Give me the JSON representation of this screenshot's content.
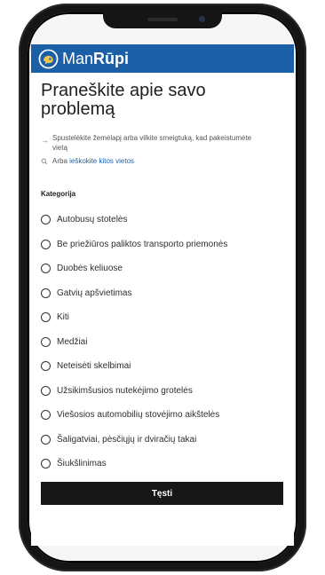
{
  "app": {
    "brand_part_1": "Man",
    "brand_part_2": "Rūpi",
    "icons": {
      "logo": "speech-bubble-logo",
      "search": "search-icon",
      "hint": "arrow-right-icon"
    },
    "colors": {
      "header": "#1b60a6",
      "link": "#1b63b0",
      "button": "#171717"
    }
  },
  "report": {
    "title": "Praneškite apie savo problemą",
    "map_hint": "Spustelėkite žemėlapį arba vilkite smeigtuką, kad pakeistumėte vietą",
    "search_prefix": "Arba ",
    "search_link": "ieškokite kitos vietos",
    "category_label": "Kategorija",
    "categories": [
      "Autobusų stotelės",
      "Be priežiūros paliktos transporto priemonės",
      "Duobės keliuose",
      "Gatvių apšvietimas",
      "Kiti",
      "Medžiai",
      "Neteisėti skelbimai",
      "Užsikimšusios nutekėjimo grotelės",
      "Viešosios automobilių stovėjimo aikštelės",
      "Šaligatviai, pėsčiųjų ir dviračių takai",
      "Šiukšlinimas"
    ],
    "submit_label": "Tęsti"
  }
}
